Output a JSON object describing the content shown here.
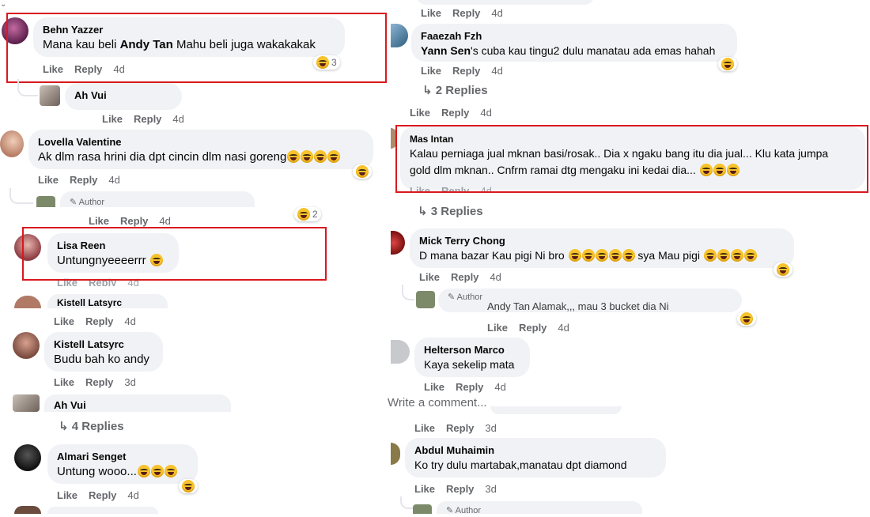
{
  "labels": {
    "like": "Like",
    "reply": "Reply",
    "author": "Author",
    "write_comment": "Write a comment..."
  },
  "left": {
    "c1": {
      "name": "Behn Yazzer",
      "pre": "Mana kau beli ",
      "tag": "Andy Tan",
      "post": " Mahu beli juga wakakakak",
      "time": "4d",
      "react_count": "3"
    },
    "c2": {
      "name": "Ah Vui",
      "time": "4d"
    },
    "c3": {
      "name": "Lovella Valentine",
      "text": "Ak dlm rasa hrini dia dpt cincin dlm nasi goreng",
      "time": "4d"
    },
    "c4": {
      "time": "4d",
      "react_count": "2"
    },
    "c5": {
      "name": "Lisa Reen",
      "text": "Untungnyeeeerrr",
      "time": "4d"
    },
    "c6": {
      "name": "Kistell Latsyrc",
      "time": "4d"
    },
    "c7": {
      "name": "Kistell Latsyrc",
      "text": "Budu bah ko andy",
      "time": "3d"
    },
    "c8": {
      "name": "Ah Vui"
    },
    "replies": "4 Replies",
    "c9": {
      "name": "Almari Senget",
      "text": "Untung wooo...",
      "time": "4d"
    }
  },
  "right": {
    "top_meta_time": "4d",
    "c1": {
      "name": "Faaezah Fzh",
      "tag": "Yann Sen",
      "post": "'s cuba kau tingu2 dulu manatau ada emas hahah",
      "time": "4d"
    },
    "replies1": "2 Replies",
    "meta2_time": "4d",
    "c2": {
      "name": "Mas Intan",
      "line1": "Kalau perniaga jual mknan basi/rosak.. Dia x ngaku bang itu dia jual... Klu kata jumpa",
      "line2": "gold dlm mknan.. Cnfrm ramai dtg mengaku ini kedai dia...",
      "time": "4d"
    },
    "replies2": "3 Replies",
    "c3": {
      "name": "Mick Terry Chong",
      "pre": "D mana bazar Kau pigi Ni bro ",
      "mid": " sya Mau pigi ",
      "time": "4d"
    },
    "c4": {
      "faded": "Andy Tan Alamak,,, mau 3 bucket dia Ni",
      "time": "4d"
    },
    "c5": {
      "name": "Helterson Marco",
      "text": "Kaya sekelip mata",
      "time": "4d"
    },
    "c6": {
      "time": "3d"
    },
    "c7": {
      "name": "Abdul Muhaimin",
      "text": "Ko try dulu martabak,manatau dpt diamond",
      "time": "3d"
    }
  }
}
